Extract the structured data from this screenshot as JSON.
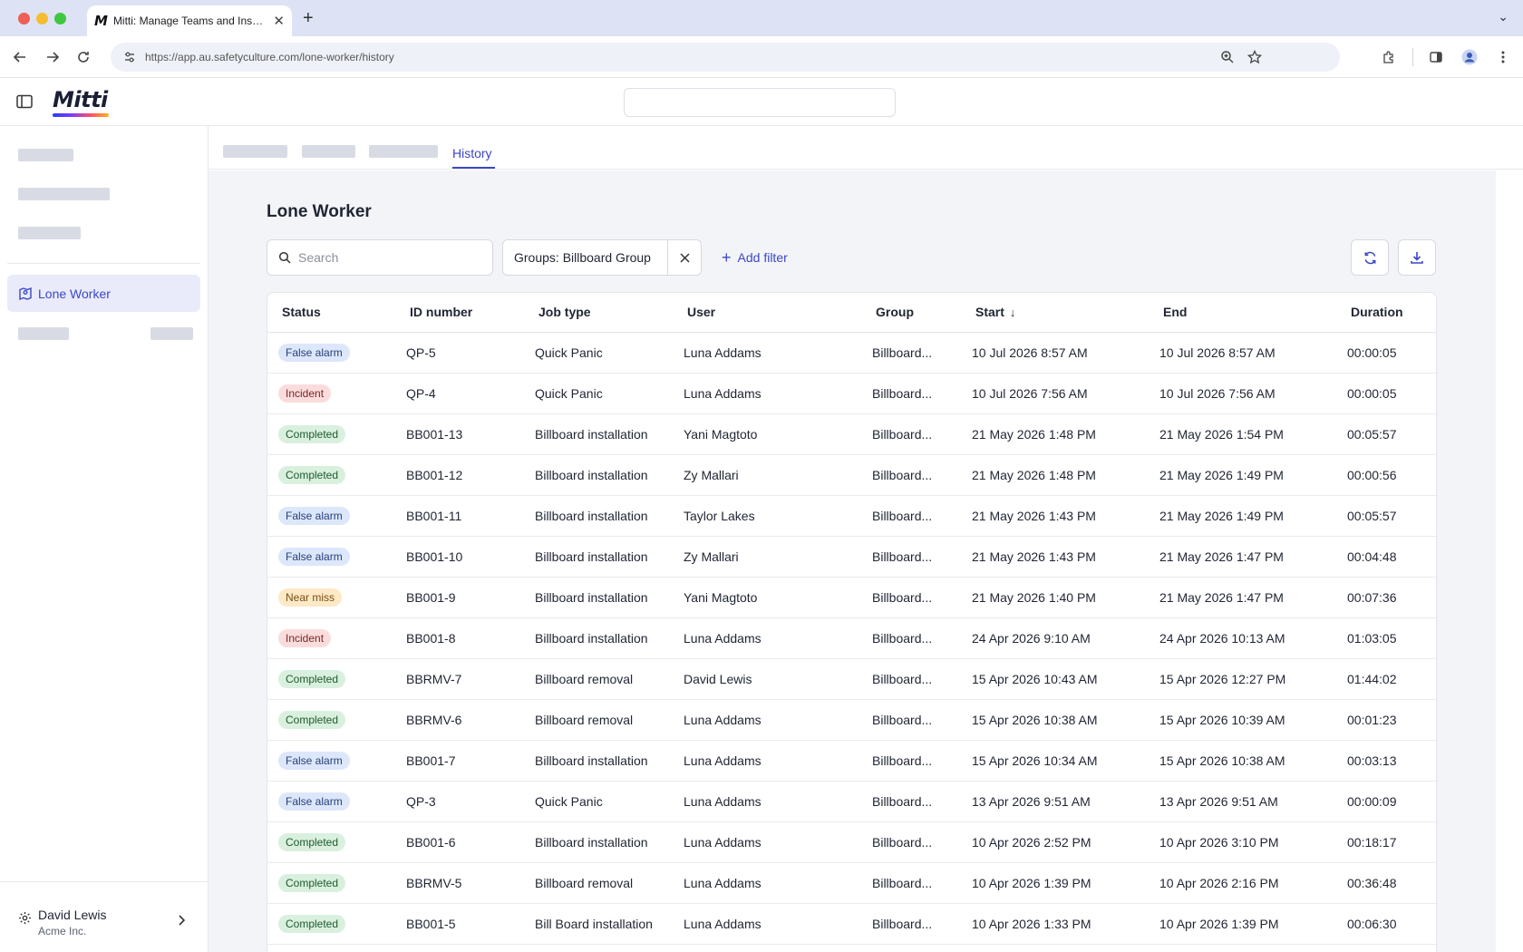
{
  "browser": {
    "tab_title": "Mitti: Manage Teams and Inspect...",
    "tab_favicon": "M",
    "url": "https://app.au.safetyculture.com/lone-worker/history"
  },
  "app": {
    "logo": "Mitti"
  },
  "sidebar": {
    "active_item": "Lone Worker",
    "user_name": "David Lewis",
    "user_org": "Acme Inc."
  },
  "tabs": {
    "active": "History"
  },
  "page": {
    "title": "Lone Worker",
    "search_placeholder": "Search",
    "filter_chip": "Groups: Billboard Group",
    "add_filter": "Add filter"
  },
  "table": {
    "columns": [
      "Status",
      "ID number",
      "Job type",
      "User",
      "Group",
      "Start",
      "End",
      "Duration"
    ],
    "rows": [
      {
        "status": "False alarm",
        "kind": "false",
        "id": "QP-5",
        "job": "Quick Panic",
        "user": "Luna Addams",
        "group": "Billboard...",
        "start": "10 Jul 2026 8:57 AM",
        "end": "10 Jul 2026 8:57 AM",
        "duration": "00:00:05"
      },
      {
        "status": "Incident",
        "kind": "incident",
        "id": "QP-4",
        "job": "Quick Panic",
        "user": "Luna Addams",
        "group": "Billboard...",
        "start": "10 Jul 2026 7:56 AM",
        "end": "10 Jul 2026 7:56 AM",
        "duration": "00:00:05"
      },
      {
        "status": "Completed",
        "kind": "completed",
        "id": "BB001-13",
        "job": "Billboard installation",
        "user": "Yani Magtoto",
        "group": "Billboard...",
        "start": "21 May 2026 1:48 PM",
        "end": "21 May 2026 1:54 PM",
        "duration": "00:05:57"
      },
      {
        "status": "Completed",
        "kind": "completed",
        "id": "BB001-12",
        "job": "Billboard installation",
        "user": "Zy Mallari",
        "group": "Billboard...",
        "start": "21 May 2026 1:48 PM",
        "end": "21 May 2026 1:49 PM",
        "duration": "00:00:56"
      },
      {
        "status": "False alarm",
        "kind": "false",
        "id": "BB001-11",
        "job": "Billboard installation",
        "user": "Taylor Lakes",
        "group": "Billboard...",
        "start": "21 May 2026 1:43 PM",
        "end": "21 May 2026 1:49 PM",
        "duration": "00:05:57"
      },
      {
        "status": "False alarm",
        "kind": "false",
        "id": "BB001-10",
        "job": "Billboard installation",
        "user": "Zy Mallari",
        "group": "Billboard...",
        "start": "21 May 2026 1:43 PM",
        "end": "21 May 2026 1:47 PM",
        "duration": "00:04:48"
      },
      {
        "status": "Near miss",
        "kind": "near",
        "id": "BB001-9",
        "job": "Billboard installation",
        "user": "Yani Magtoto",
        "group": "Billboard...",
        "start": "21 May 2026 1:40 PM",
        "end": "21 May 2026 1:47 PM",
        "duration": "00:07:36"
      },
      {
        "status": "Incident",
        "kind": "incident",
        "id": "BB001-8",
        "job": "Billboard installation",
        "user": "Luna Addams",
        "group": "Billboard...",
        "start": "24 Apr 2026 9:10 AM",
        "end": "24 Apr 2026 10:13 AM",
        "duration": "01:03:05"
      },
      {
        "status": "Completed",
        "kind": "completed",
        "id": "BBRMV-7",
        "job": "Billboard removal",
        "user": "David Lewis",
        "group": "Billboard...",
        "start": "15 Apr 2026 10:43 AM",
        "end": "15 Apr 2026 12:27 PM",
        "duration": "01:44:02"
      },
      {
        "status": "Completed",
        "kind": "completed",
        "id": "BBRMV-6",
        "job": "Billboard removal",
        "user": "Luna Addams",
        "group": "Billboard...",
        "start": "15 Apr 2026 10:38 AM",
        "end": "15 Apr 2026 10:39 AM",
        "duration": "00:01:23"
      },
      {
        "status": "False alarm",
        "kind": "false",
        "id": "BB001-7",
        "job": "Billboard installation",
        "user": "Luna Addams",
        "group": "Billboard...",
        "start": "15 Apr 2026 10:34 AM",
        "end": "15 Apr 2026 10:38 AM",
        "duration": "00:03:13"
      },
      {
        "status": "False alarm",
        "kind": "false",
        "id": "QP-3",
        "job": "Quick Panic",
        "user": "Luna Addams",
        "group": "Billboard...",
        "start": "13 Apr 2026 9:51 AM",
        "end": "13 Apr 2026 9:51 AM",
        "duration": "00:00:09"
      },
      {
        "status": "Completed",
        "kind": "completed",
        "id": "BB001-6",
        "job": "Billboard installation",
        "user": "Luna Addams",
        "group": "Billboard...",
        "start": "10 Apr 2026 2:52 PM",
        "end": "10 Apr 2026 3:10 PM",
        "duration": "00:18:17"
      },
      {
        "status": "Completed",
        "kind": "completed",
        "id": "BBRMV-5",
        "job": "Billboard removal",
        "user": "Luna Addams",
        "group": "Billboard...",
        "start": "10 Apr 2026 1:39 PM",
        "end": "10 Apr 2026 2:16 PM",
        "duration": "00:36:48"
      },
      {
        "status": "Completed",
        "kind": "completed",
        "id": "BB001-5",
        "job": "Bill Board installation",
        "user": "Luna Addams",
        "group": "Billboard...",
        "start": "10 Apr 2026 1:33 PM",
        "end": "10 Apr 2026 1:39 PM",
        "duration": "00:06:30"
      }
    ]
  }
}
